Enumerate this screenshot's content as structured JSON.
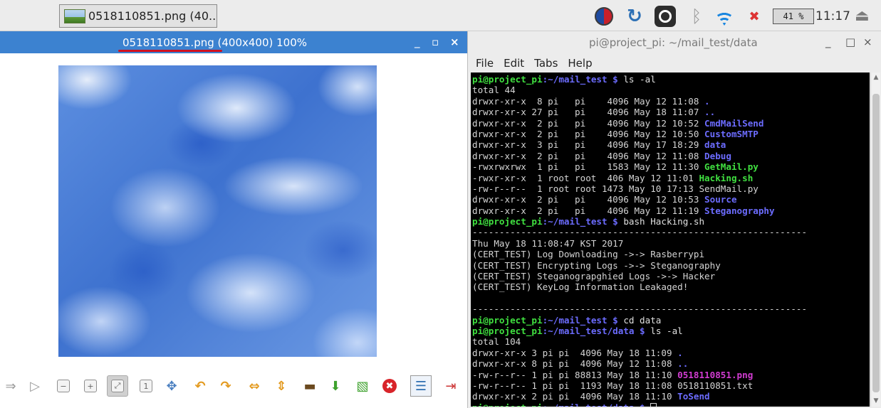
{
  "taskbar": {
    "task_button_label": "0518110851.png (40...",
    "cpu_monitor": "41 %",
    "clock": "11:17"
  },
  "viewer": {
    "title_filename": "0518110851.png",
    "title_rest": " (400x400) 100%",
    "window_controls": {
      "minimize": "_",
      "maximize": "▫",
      "close": "×"
    }
  },
  "terminal": {
    "title": "pi@project_pi: ~/mail_test/data",
    "window_controls": {
      "minimize": "_",
      "maximize": "□",
      "close": "×"
    },
    "menu": [
      "File",
      "Edit",
      "Tabs",
      "Help"
    ],
    "lines": [
      [
        {
          "t": "pi@project_pi",
          "c": "prompt"
        },
        {
          "t": ":~/mail_test $ ",
          "c": "path"
        },
        {
          "t": "ls -al",
          "c": "cmd"
        }
      ],
      [
        {
          "t": "total 44",
          "c": "text"
        }
      ],
      [
        {
          "t": "drwxr-xr-x  8 pi   pi    4096 May 12 11:08 ",
          "c": "text"
        },
        {
          "t": ".",
          "c": "dir"
        }
      ],
      [
        {
          "t": "drwxr-xr-x 27 pi   pi    4096 May 18 11:07 ",
          "c": "text"
        },
        {
          "t": "..",
          "c": "dir"
        }
      ],
      [
        {
          "t": "drwxr-xr-x  2 pi   pi    4096 May 12 10:52 ",
          "c": "text"
        },
        {
          "t": "CmdMailSend",
          "c": "dir"
        }
      ],
      [
        {
          "t": "drwxr-xr-x  2 pi   pi    4096 May 12 10:50 ",
          "c": "text"
        },
        {
          "t": "CustomSMTP",
          "c": "dir"
        }
      ],
      [
        {
          "t": "drwxr-xr-x  3 pi   pi    4096 May 17 18:29 ",
          "c": "text"
        },
        {
          "t": "data",
          "c": "dir"
        }
      ],
      [
        {
          "t": "drwxr-xr-x  2 pi   pi    4096 May 12 11:08 ",
          "c": "text"
        },
        {
          "t": "Debug",
          "c": "dir"
        }
      ],
      [
        {
          "t": "-rwxrwxrwx  1 pi   pi    1583 May 12 11:30 ",
          "c": "text"
        },
        {
          "t": "GetMail.py",
          "c": "exec"
        }
      ],
      [
        {
          "t": "-rwxr-xr-x  1 root root  406 May 12 11:01 ",
          "c": "text"
        },
        {
          "t": "Hacking.sh",
          "c": "exec"
        }
      ],
      [
        {
          "t": "-rw-r--r--  1 root root 1473 May 10 17:13 ",
          "c": "text"
        },
        {
          "t": "SendMail.py",
          "c": "text"
        }
      ],
      [
        {
          "t": "drwxr-xr-x  2 pi   pi    4096 May 12 10:53 ",
          "c": "text"
        },
        {
          "t": "Source",
          "c": "dir"
        }
      ],
      [
        {
          "t": "drwxr-xr-x  2 pi   pi    4096 May 12 11:19 ",
          "c": "text"
        },
        {
          "t": "Steganography",
          "c": "dir"
        }
      ],
      [
        {
          "t": "pi@project_pi",
          "c": "prompt"
        },
        {
          "t": ":~/mail_test $ ",
          "c": "path"
        },
        {
          "t": "bash Hacking.sh",
          "c": "cmd"
        }
      ],
      [
        {
          "t": "--------------------------------------------------------------",
          "c": "sep"
        }
      ],
      [
        {
          "t": "Thu May 18 11:08:47 KST 2017",
          "c": "text"
        }
      ],
      [
        {
          "t": "(CERT_TEST) Log Downloading ->-> Rasberrypi",
          "c": "text"
        }
      ],
      [
        {
          "t": "(CERT_TEST) Encrypting Logs ->-> Steganography",
          "c": "text"
        }
      ],
      [
        {
          "t": "(CERT_TEST) Steganograpghied Logs ->-> Hacker",
          "c": "text"
        }
      ],
      [
        {
          "t": "(CERT_TEST) KeyLog Information Leakaged!",
          "c": "text"
        }
      ],
      [
        {
          "t": "",
          "c": "text"
        }
      ],
      [
        {
          "t": "--------------------------------------------------------------",
          "c": "sep"
        }
      ],
      [
        {
          "t": "pi@project_pi",
          "c": "prompt"
        },
        {
          "t": ":~/mail_test $ ",
          "c": "path"
        },
        {
          "t": "cd data",
          "c": "cmd"
        }
      ],
      [
        {
          "t": "pi@project_pi",
          "c": "prompt"
        },
        {
          "t": ":~/mail_test/data $ ",
          "c": "path"
        },
        {
          "t": "ls -al",
          "c": "cmd"
        }
      ],
      [
        {
          "t": "total 104",
          "c": "text"
        }
      ],
      [
        {
          "t": "drwxr-xr-x 3 pi pi  4096 May 18 11:09 ",
          "c": "text"
        },
        {
          "t": ".",
          "c": "dir"
        }
      ],
      [
        {
          "t": "drwxr-xr-x 8 pi pi  4096 May 12 11:08 ",
          "c": "text"
        },
        {
          "t": "..",
          "c": "dir"
        }
      ],
      [
        {
          "t": "-rw-r--r-- 1 pi pi 88813 May 18 11:10 ",
          "c": "text"
        },
        {
          "t": "0518110851.png",
          "c": "img"
        }
      ],
      [
        {
          "t": "-rw-r--r-- 1 pi pi  1193 May 18 11:08 ",
          "c": "text"
        },
        {
          "t": "0518110851.txt",
          "c": "text"
        }
      ],
      [
        {
          "t": "drwxr-xr-x 2 pi pi  4096 May 18 11:10 ",
          "c": "text"
        },
        {
          "t": "ToSend",
          "c": "dir"
        }
      ],
      [
        {
          "t": "pi@project_pi",
          "c": "prompt"
        },
        {
          "t": ":~/mail_test/data $ ",
          "c": "path"
        },
        {
          "t": "",
          "c": "cursor"
        }
      ]
    ]
  },
  "icons": {
    "taskbar_tray": [
      "korean-input-icon",
      "swirl-icon",
      "vnc-icon",
      "bluetooth-icon",
      "wifi-icon",
      "volume-muted-icon",
      "eject-icon"
    ],
    "viewer_toolbar": [
      "prev-icon",
      "next-icon",
      "zoom-out-icon",
      "zoom-in-icon",
      "fit-icon",
      "original-size-icon",
      "fullscreen-icon",
      "rotate-left-icon",
      "rotate-right-icon",
      "flip-horizontal-icon",
      "flip-vertical-icon",
      "open-icon",
      "save-icon",
      "save-as-icon",
      "delete-icon",
      "preferences-icon",
      "quit-icon"
    ]
  },
  "colors": {
    "viewer_title_bg": "#3c82d0",
    "terminal_bg": "#000000",
    "prompt": "#40e040",
    "directory": "#6c6cff",
    "image_file": "#d23cd2",
    "annotation_underline": "#d01020"
  }
}
